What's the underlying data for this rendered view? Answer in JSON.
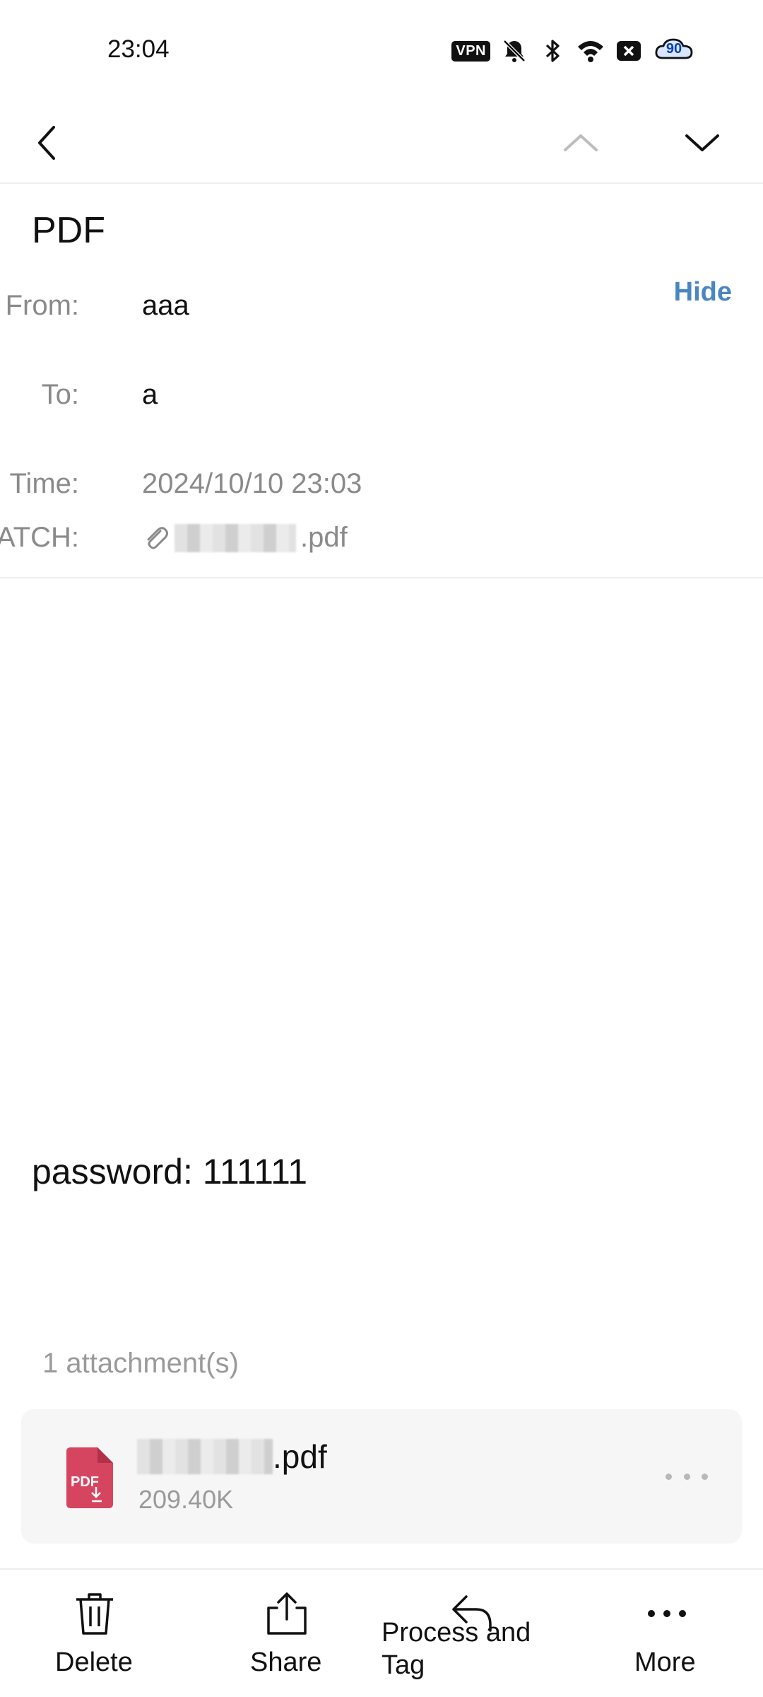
{
  "status_bar": {
    "time": "23:04",
    "vpn_label": "VPN",
    "battery_level": "90",
    "icons": [
      "vpn-icon",
      "bell-off-icon",
      "bluetooth-icon",
      "wifi-icon",
      "sim-off-icon",
      "battery-icon"
    ]
  },
  "nav": {
    "icons": [
      "back-icon",
      "previous-mail-icon",
      "next-mail-icon"
    ]
  },
  "email": {
    "subject": "PDF",
    "hide_label": "Hide",
    "from_label": "From:",
    "from_value": "aaa",
    "to_label": "To:",
    "to_value": "a",
    "time_label": "Time:",
    "time_value": "2024/10/10 23:03",
    "attach_label": "ATCH:",
    "attach_ext": ".pdf",
    "body": "password: 111111"
  },
  "attachments": {
    "count_label": "1 attachment(s)",
    "items": [
      {
        "name_ext": ".pdf",
        "size": "209.40K",
        "icon": "pdf-file-icon"
      }
    ]
  },
  "toolbar": {
    "delete_label": "Delete",
    "share_label": "Share",
    "process_label": "Process and Tag",
    "more_label": "More"
  },
  "colors": {
    "accent": "#4a86c0",
    "pdf_icon": "#d6455f",
    "muted_text": "#8a8a8a"
  }
}
